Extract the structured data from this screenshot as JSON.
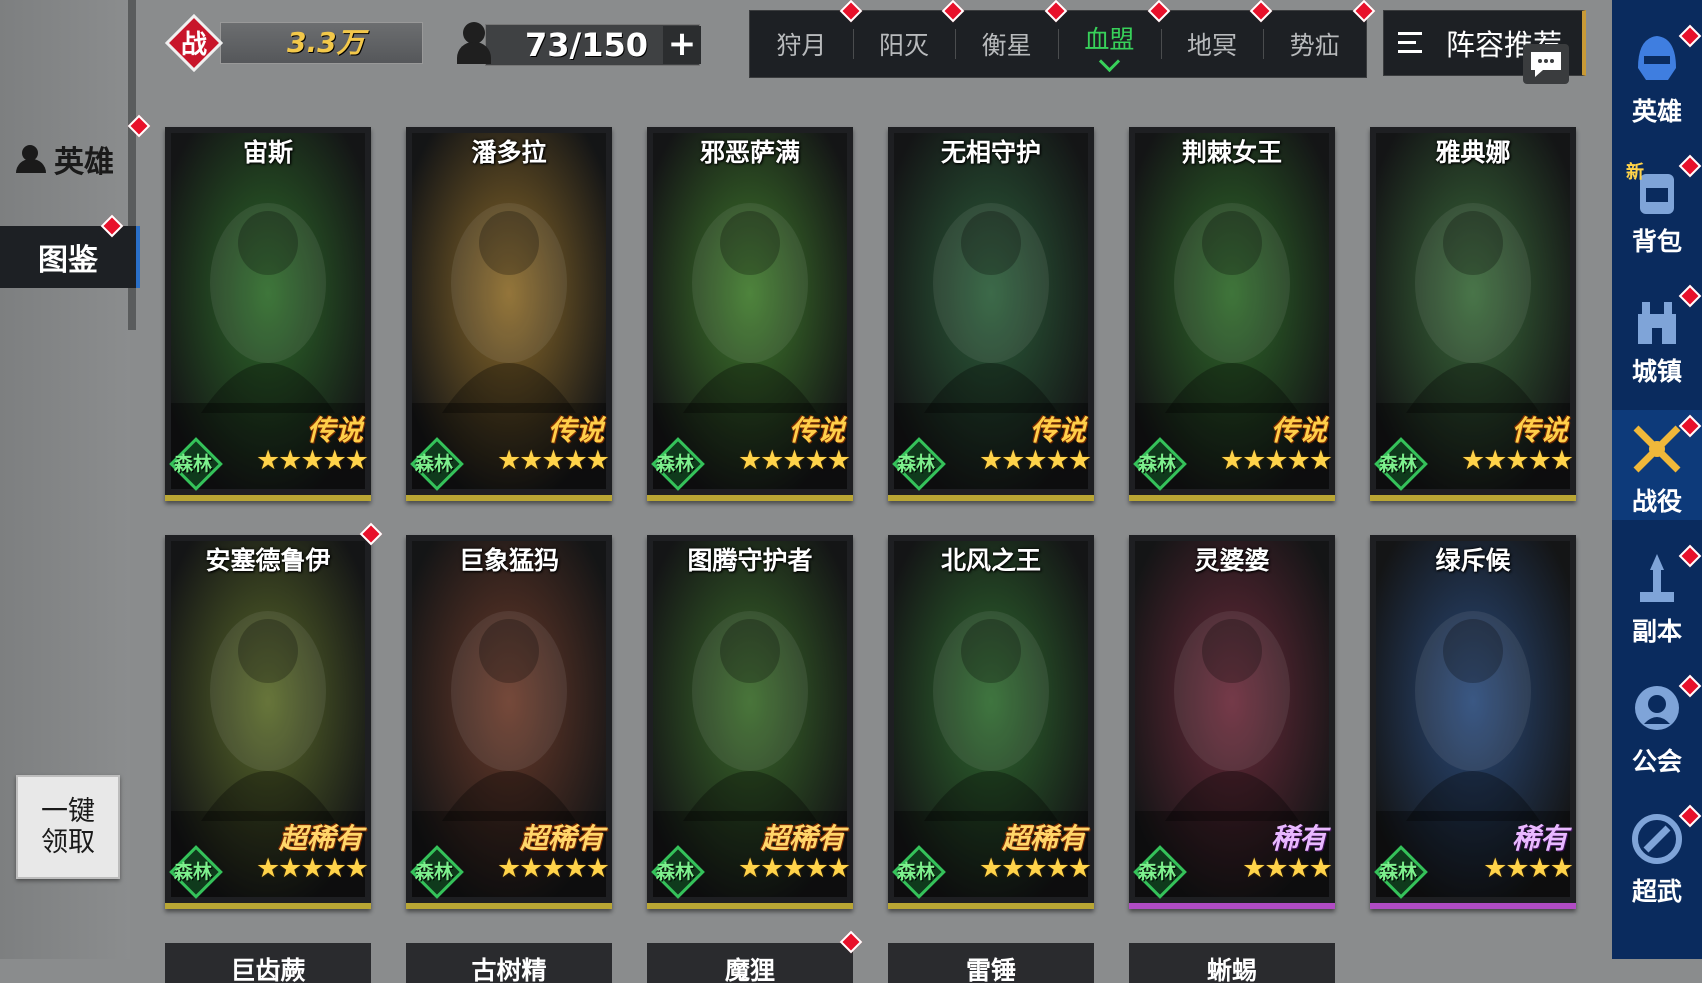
{
  "left_panel": {
    "tabs": [
      {
        "label": "英雄",
        "active": false
      },
      {
        "label": "图鉴",
        "active": true
      }
    ],
    "claim_all_lines": [
      "一键",
      "领取"
    ]
  },
  "top_bar": {
    "power_emblem": "战",
    "power_value": "3.3万",
    "stamina_value": "73/150",
    "stamina_add": "+",
    "faction_tabs": [
      {
        "label": "狩月",
        "active": false
      },
      {
        "label": "阳灭",
        "active": false
      },
      {
        "label": "衡星",
        "active": false
      },
      {
        "label": "血盟",
        "active": true
      },
      {
        "label": "地冥",
        "active": false
      },
      {
        "label": "势疝",
        "active": false
      }
    ],
    "recommend_label": "阵容推荐"
  },
  "right_nav": [
    {
      "label": "英雄",
      "icon": "helmet-icon"
    },
    {
      "label": "背包",
      "icon": "backpack-icon",
      "badge": "新"
    },
    {
      "label": "城镇",
      "icon": "castle-icon"
    },
    {
      "label": "战役",
      "icon": "crossed-swords-icon",
      "active": true
    },
    {
      "label": "副本",
      "icon": "dungeon-icon"
    },
    {
      "label": "公会",
      "icon": "guild-icon"
    },
    {
      "label": "超武",
      "icon": "super-weapon-icon"
    }
  ],
  "heroes": [
    {
      "name": "宙斯",
      "faction": "森林",
      "rarity": "传说",
      "stars": 5,
      "color": "#2e6b2a"
    },
    {
      "name": "潘多拉",
      "faction": "森林",
      "rarity": "传说",
      "stars": 5,
      "color": "#8b6a2a"
    },
    {
      "name": "邪恶萨满",
      "faction": "森林",
      "rarity": "传说",
      "stars": 5,
      "color": "#3f7a2c"
    },
    {
      "name": "无相守护",
      "faction": "森林",
      "rarity": "传说",
      "stars": 5,
      "color": "#2c5e3a"
    },
    {
      "name": "荆棘女王",
      "faction": "森林",
      "rarity": "传说",
      "stars": 5,
      "color": "#2f6a2a"
    },
    {
      "name": "雅典娜",
      "faction": "森林",
      "rarity": "传说",
      "stars": 5,
      "color": "#3a6a3a"
    },
    {
      "name": "安塞德鲁伊",
      "faction": "森林",
      "rarity": "超稀有",
      "stars": 5,
      "color": "#5a6a2a"
    },
    {
      "name": "巨象猛犸",
      "faction": "森林",
      "rarity": "超稀有",
      "stars": 5,
      "color": "#6a3a2a"
    },
    {
      "name": "图腾守护者",
      "faction": "森林",
      "rarity": "超稀有",
      "stars": 5,
      "color": "#3a6a2a"
    },
    {
      "name": "北风之王",
      "faction": "森林",
      "rarity": "超稀有",
      "stars": 5,
      "color": "#2f6a2f"
    },
    {
      "name": "灵婆婆",
      "faction": "森林",
      "rarity": "稀有",
      "stars": 4,
      "color": "#6a2a3a"
    },
    {
      "name": "绿斥候",
      "faction": "森林",
      "rarity": "稀有",
      "stars": 4,
      "color": "#2a4a7a"
    }
  ],
  "peek_row": [
    "巨齿蕨",
    "古树精",
    "魔狸",
    "雷锤",
    "蜥蜴"
  ]
}
